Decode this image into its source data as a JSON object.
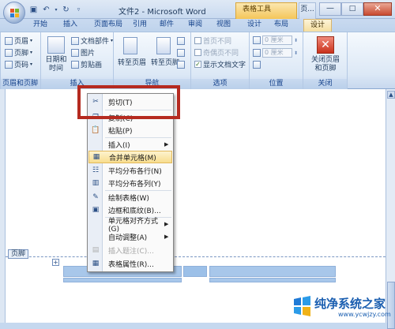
{
  "window": {
    "title": "文件2 - Microsoft Word",
    "table_tools": "表格工具",
    "page_tab_abbrev": "页...",
    "controls": {
      "minimize": "—",
      "maximize": "□",
      "close": "✕"
    }
  },
  "tabs": [
    {
      "label": "开始"
    },
    {
      "label": "插入"
    },
    {
      "label": "页面布局"
    },
    {
      "label": "引用"
    },
    {
      "label": "邮件"
    },
    {
      "label": "审阅"
    },
    {
      "label": "视图"
    },
    {
      "label": "设计"
    },
    {
      "label": "布局"
    },
    {
      "label": "设计",
      "active": true
    }
  ],
  "ribbon": {
    "header_footer": {
      "header": "页眉",
      "footer": "页脚",
      "page_number": "页码",
      "group": "页眉和页脚"
    },
    "insert": {
      "date_time": "日期和\n时间",
      "doc_parts": "文档部件",
      "picture": "图片",
      "clipart": "剪贴画",
      "group": "插入"
    },
    "navigation": {
      "goto_header": "转至页眉",
      "goto_footer": "转至页脚",
      "group": "导航"
    },
    "options": {
      "first_page": "首页不同",
      "odd_even": "奇偶页不同",
      "show_text": "显示文档文字",
      "group": "选项"
    },
    "position": {
      "top_value": "0 厘米",
      "bottom_value": "0 厘米",
      "group": "位置"
    },
    "close": {
      "label": "关闭页眉\n和页脚",
      "group": "关闭"
    }
  },
  "document": {
    "footer_tag": "页脚"
  },
  "context_menu": [
    {
      "label": "剪切(T)",
      "icon": "scissors-icon"
    },
    {
      "label": "复制(C)",
      "icon": "copy-icon"
    },
    {
      "label": "粘贴(P)",
      "icon": "paste-icon"
    },
    {
      "label": "插入(I)",
      "submenu": true
    },
    {
      "label": "合并单元格(M)",
      "icon": "merge-cells-icon",
      "highlighted": true
    },
    {
      "label": "平均分布各行(N)",
      "icon": "distribute-rows-icon"
    },
    {
      "label": "平均分布各列(Y)",
      "icon": "distribute-columns-icon"
    },
    {
      "label": "绘制表格(W)",
      "icon": "draw-table-icon"
    },
    {
      "label": "边框和底纹(B)...",
      "icon": "borders-icon"
    },
    {
      "label": "单元格对齐方式(G)",
      "submenu": true
    },
    {
      "label": "自动调整(A)",
      "submenu": true
    },
    {
      "label": "插入题注(C)...",
      "icon": "caption-icon",
      "disabled": true
    },
    {
      "label": "表格属性(R)...",
      "icon": "table-properties-icon"
    }
  ],
  "watermark": {
    "text": "纯净系统之家",
    "url": "www.ycwjzy.com"
  },
  "colors": {
    "accent": "#15428b",
    "highlight_box": "#b52a20",
    "menu_highlight": "#f8dd8e"
  }
}
